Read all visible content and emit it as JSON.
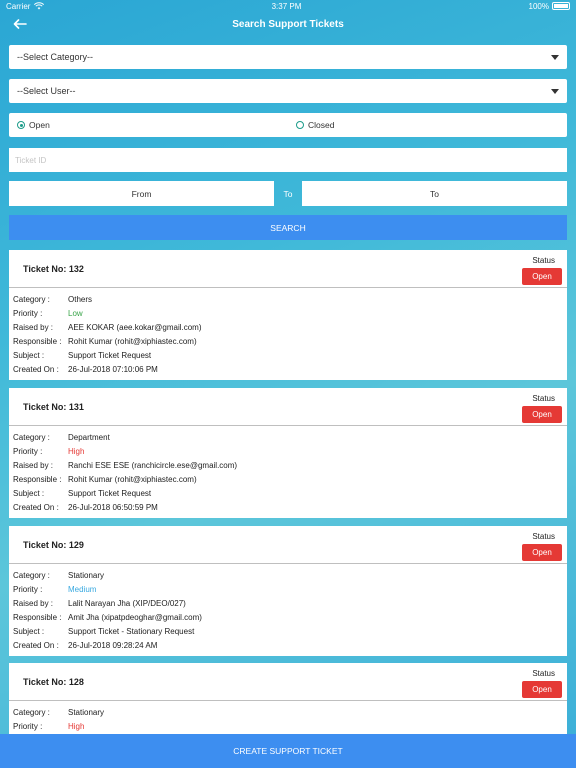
{
  "statusbar": {
    "carrier": "Carrier",
    "time": "3:37 PM",
    "battery": "100%"
  },
  "header": {
    "title": "Search Support Tickets",
    "back_icon": "arrow-left-icon"
  },
  "filters": {
    "category_placeholder": "--Select Category--",
    "user_placeholder": "--Select User--",
    "status_options": [
      {
        "label": "Open",
        "checked": true
      },
      {
        "label": "Closed",
        "checked": false
      }
    ],
    "ticket_id_placeholder": "Ticket ID",
    "from_label": "From",
    "to_separator": "To",
    "to_label": "To",
    "search_label": "SEARCH"
  },
  "field_labels": {
    "category": "Category :",
    "priority": "Priority :",
    "raised_by": "Raised by :",
    "responsible": "Responsible :",
    "subject": "Subject :",
    "created_on": "Created On :",
    "status": "Status"
  },
  "tickets": [
    {
      "number": "Ticket No: 132",
      "status_button": "Open",
      "category": "Others",
      "priority": "Low",
      "priority_color": "#3aa54a",
      "raised_by": "AEE  KOKAR (aee.kokar@gmail.com)",
      "responsible": "Rohit  Kumar (rohit@xiphiastec.com)",
      "subject": "Support Ticket Request",
      "created_on": "26-Jul-2018 07:10:06 PM"
    },
    {
      "number": "Ticket No: 131",
      "status_button": "Open",
      "category": "Department",
      "priority": "High",
      "priority_color": "#e53935",
      "raised_by": "Ranchi ESE  ESE (ranchicircle.ese@gmail.com)",
      "responsible": "Rohit  Kumar (rohit@xiphiastec.com)",
      "subject": "Support Ticket Request",
      "created_on": "26-Jul-2018 06:50:59 PM"
    },
    {
      "number": "Ticket No: 129",
      "status_button": "Open",
      "category": "Stationary",
      "priority": "Medium",
      "priority_color": "#39a9e0",
      "raised_by": "Lalit Narayan Jha (XIP/DEO/027)",
      "responsible": "Amit  Jha (xipatpdeoghar@gmail.com)",
      "subject": "Support Ticket - Stationary Request",
      "created_on": "26-Jul-2018 09:28:24 AM"
    },
    {
      "number": "Ticket No: 128",
      "status_button": "Open",
      "category": "Stationary",
      "priority": "High",
      "priority_color": "#e53935"
    }
  ],
  "footer": {
    "create_label": "CREATE SUPPORT TICKET"
  },
  "colors": {
    "accent_blue": "#3d8ef0",
    "open_red": "#e53935",
    "radio_teal": "#1c9c8a"
  }
}
